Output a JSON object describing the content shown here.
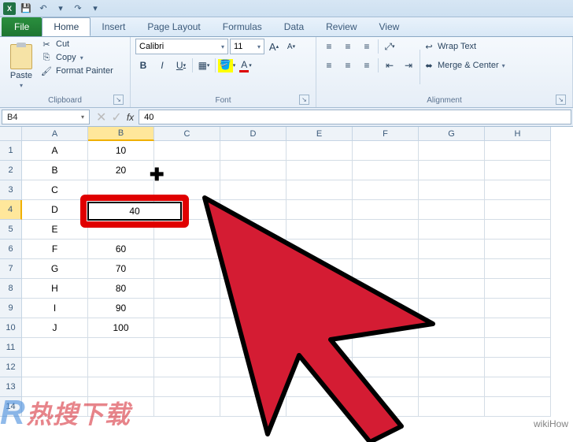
{
  "qat": {
    "excel_badge": "X",
    "save": "💾",
    "undo": "↶",
    "redo": "↷"
  },
  "tabs": {
    "file": "File",
    "items": [
      "Home",
      "Insert",
      "Page Layout",
      "Formulas",
      "Data",
      "Review",
      "View"
    ],
    "active": "Home"
  },
  "ribbon": {
    "clipboard": {
      "label": "Clipboard",
      "paste": "Paste",
      "cut": "Cut",
      "copy": "Copy",
      "format_painter": "Format Painter"
    },
    "font": {
      "label": "Font",
      "name": "Calibri",
      "size": "11",
      "grow": "A",
      "shrink": "A",
      "bold": "B",
      "italic": "I",
      "underline": "U",
      "fill": "▦",
      "color": "A"
    },
    "alignment": {
      "label": "Alignment",
      "wrap": "Wrap Text",
      "merge": "Merge & Center"
    }
  },
  "namebox": "B4",
  "formula_value": "40",
  "columns": [
    "A",
    "B",
    "C",
    "D",
    "E",
    "F",
    "G",
    "H"
  ],
  "active_col": "B",
  "active_row": 4,
  "row_count": 14,
  "cells": {
    "A": [
      "A",
      "B",
      "C",
      "D",
      "E",
      "F",
      "G",
      "H",
      "I",
      "J"
    ],
    "B": [
      "10",
      "20",
      "",
      "40",
      "",
      "60",
      "70",
      "80",
      "90",
      "100"
    ]
  },
  "highlighted_value": "40",
  "watermark_right": "wikiHow",
  "watermark_left_R": "R",
  "watermark_left_zh": "热搜下载"
}
